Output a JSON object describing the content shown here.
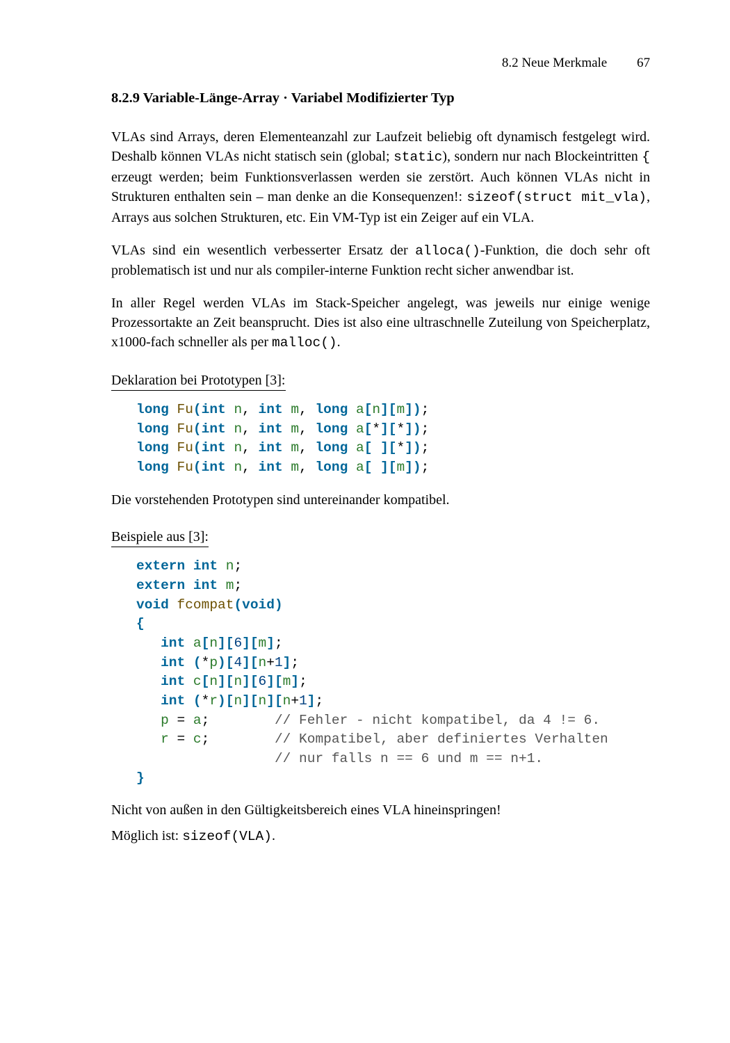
{
  "header": {
    "section_label": "8.2  Neue Merkmale",
    "page_number": "67"
  },
  "title": "8.2.9  Variable-Länge-Array · Variabel Modifizierter Typ",
  "para1": {
    "t1": "VLAs sind Arrays, deren Elementeanzahl zur Laufzeit beliebig oft dynamisch festgelegt wird. Deshalb können VLAs nicht statisch sein (global; ",
    "c1": "static",
    "t2": "), sondern nur nach Blockeintritten ",
    "c2": "{",
    "t3": " erzeugt werden; beim Funktionsverlassen werden sie zerstört. Auch können VLAs nicht in Strukturen enthalten sein – man denke an die Konsequenzen!: ",
    "c3": "sizeof(struct mit_vla)",
    "t4": ", Arrays aus solchen Strukturen, etc. Ein VM-Typ ist ein Zeiger auf ein VLA."
  },
  "para2": {
    "t1": "VLAs sind ein wesentlich verbesserter Ersatz der ",
    "c1": "alloca()",
    "t2": "-Funktion, die doch sehr oft problematisch ist und nur als compiler-interne Funktion recht sicher anwendbar ist."
  },
  "para3": {
    "t1": "In aller Regel werden VLAs im Stack-Speicher angelegt, was jeweils nur einige wenige Prozessortakte an Zeit beansprucht. Dies ist also eine ultraschnelle Zuteilung von Speicherplatz, x1000-fach schneller als per ",
    "c1": "malloc()",
    "t2": "."
  },
  "label1": "Deklaration bei Prototypen [3]:",
  "code1": {
    "long": "long",
    "Fu": "Fu",
    "int": "int",
    "n": "n",
    "m": "m",
    "a": "a",
    "star": "*",
    "lb": "[",
    "rb": "]",
    "lp": "(",
    "rp": ")",
    "cm": ",",
    "sc": ";"
  },
  "para4": "Die vorstehenden Prototypen sind untereinander kompatibel.",
  "label2": "Beispiele aus [3]:",
  "code2": {
    "extern": "extern",
    "int": "int",
    "void": "void",
    "n": "n",
    "m": "m",
    "a": "a",
    "p": "p",
    "c": "c",
    "r": "r",
    "fcompat": "fcompat",
    "lbrace": "{",
    "rbrace": "}",
    "num6": "6",
    "num4": "4",
    "num1": "1",
    "star": "*",
    "plus": "+",
    "eq": "=",
    "sc": ";",
    "lb": "[",
    "rb": "]",
    "lp": "(",
    "rp": ")",
    "comment1": "// Fehler - nicht kompatibel, da 4 != 6.",
    "comment2": "// Kompatibel, aber definiertes Verhalten",
    "comment3": "// nur falls n == 6 und m == n+1."
  },
  "para5": "Nicht von außen in den Gültigkeitsbereich eines VLA hineinspringen!",
  "para6": {
    "t1": "Möglich ist: ",
    "c1": "sizeof(VLA)",
    "t2": "."
  }
}
